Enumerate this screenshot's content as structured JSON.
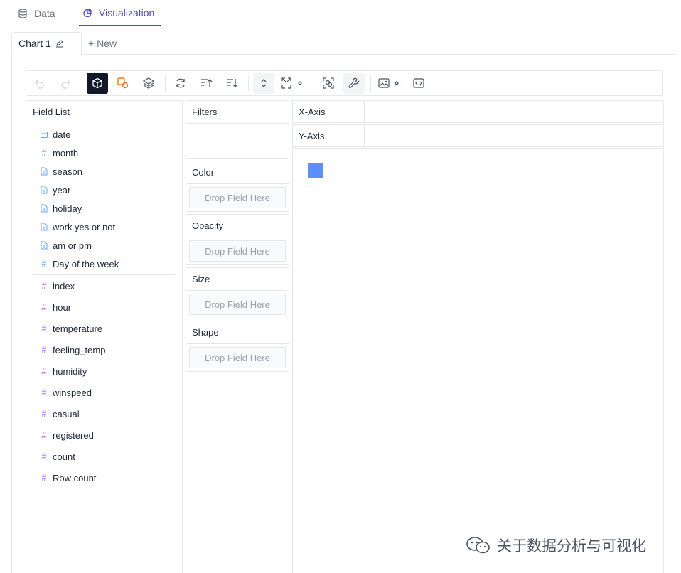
{
  "top_tabs": {
    "data": "Data",
    "visualization": "Visualization"
  },
  "chart_tabs": {
    "active": "Chart 1",
    "new": "+ New"
  },
  "field_list": {
    "title": "Field List",
    "dimensions": [
      {
        "name": "date",
        "icon": "calendar-icon"
      },
      {
        "name": "month",
        "icon": "hash-icon"
      },
      {
        "name": "season",
        "icon": "text-file-icon"
      },
      {
        "name": "year",
        "icon": "text-file-icon"
      },
      {
        "name": "holiday",
        "icon": "text-file-icon"
      },
      {
        "name": "work yes or not",
        "icon": "text-file-icon"
      },
      {
        "name": "am or pm",
        "icon": "text-file-icon"
      },
      {
        "name": "Day of the week",
        "icon": "hash-icon"
      }
    ],
    "measures": [
      {
        "name": "index"
      },
      {
        "name": "hour"
      },
      {
        "name": "temperature"
      },
      {
        "name": "feeling_temp"
      },
      {
        "name": "humidity"
      },
      {
        "name": "winspeed"
      },
      {
        "name": "casual"
      },
      {
        "name": "registered"
      },
      {
        "name": "count"
      },
      {
        "name": "Row count"
      }
    ]
  },
  "encodings": {
    "filters": "Filters",
    "color": "Color",
    "opacity": "Opacity",
    "size": "Size",
    "shape": "Shape",
    "drop_text": "Drop Field Here"
  },
  "axes": {
    "x": "X-Axis",
    "y": "Y-Axis"
  },
  "watermark": "关于数据分析与可视化",
  "colors": {
    "accent": "#4f46e5",
    "mark": "#5b8ff9",
    "dim_icon": "#60a5fa",
    "measure_icon": "#a855f7"
  }
}
